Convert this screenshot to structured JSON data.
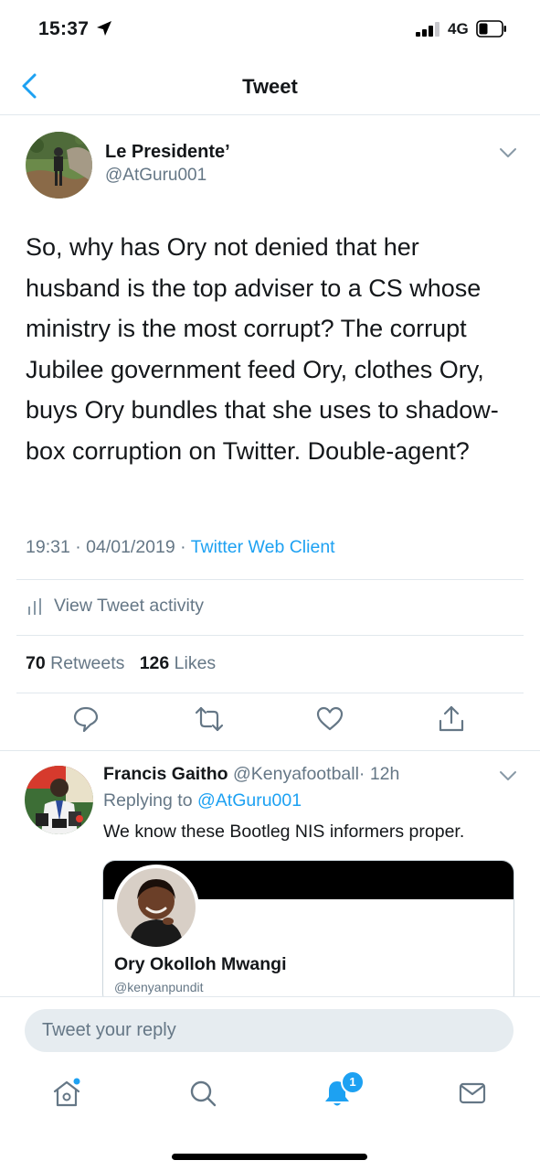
{
  "status_bar": {
    "time": "15:37",
    "network": "4G"
  },
  "nav": {
    "title": "Tweet"
  },
  "tweet": {
    "author_name": "Le Presidente’",
    "author_handle": "@AtGuru001",
    "text": "So, why has Ory not denied that her husband is the top adviser to a CS whose ministry is the most corrupt? The corrupt Jubilee government feed Ory, clothes Ory, buys Ory bundles that she uses to shadow-box corruption on Twitter. Double-agent?",
    "timestamp": "19:31 · 04/01/2019 ·",
    "client": "Twitter Web Client",
    "activity_label": "View Tweet activity",
    "retweets_count": "70",
    "retweets_label": "Retweets",
    "likes_count": "126",
    "likes_label": "Likes"
  },
  "reply": {
    "author_name": "Francis Gaitho",
    "author_handle": "@Kenyafootball",
    "time": "· 12h",
    "replying_to_label": "Replying to",
    "replying_to_handle": "@AtGuru001",
    "text": "We know these Bootleg NIS informers proper.",
    "card": {
      "name": "Ory Okolloh Mwangi",
      "handle": "@kenyanpundit"
    }
  },
  "composer": {
    "placeholder": "Tweet your reply"
  },
  "tabbar": {
    "notifications_badge": "1"
  },
  "colors": {
    "accent": "#1da1f2",
    "secondary_text": "#657786",
    "divider": "#e1e8ed"
  },
  "icons": [
    "back-chevron-icon",
    "chevron-down-icon",
    "bar-chart-icon",
    "reply-icon",
    "retweet-icon",
    "like-icon",
    "share-icon",
    "home-icon",
    "search-icon",
    "notifications-icon",
    "messages-icon"
  ]
}
